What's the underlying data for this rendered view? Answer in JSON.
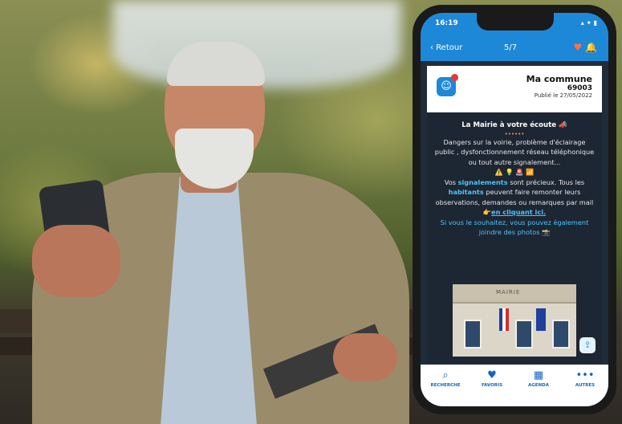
{
  "phone": {
    "status": {
      "time": "16:19",
      "system_icons": "▴ ✦ ▮"
    },
    "nav": {
      "back_label": "Retour",
      "pager": "5/7",
      "heart_icon": "heart-icon",
      "bell_icon": "bell-icon"
    },
    "card": {
      "commune_name": "Ma commune",
      "postal_code": "69003",
      "published": "Publié le 27/05/2022"
    },
    "article": {
      "title": "La Mairie à votre écoute 📣",
      "dots": "••••••",
      "p1": "Dangers sur la voirie, problème d'éclairage public , dysfonctionnement réseau téléphonique ou tout autre signalement...",
      "emoji_row": "⚠️ 💡 🚨 📶",
      "p2_a": "Vos ",
      "p2_hl1": "signalements",
      "p2_b": " sont précieux. Tous les ",
      "p2_hl2": "habitants",
      "p2_c": " peuvent faire remonter leurs observations, demandes ou remarques par mail 👉",
      "p2_link": "en cliquant ici.",
      "p3": "Si vous le souhaitez, vous pouvez également joindre des photos 📸",
      "image_sign": "MAIRIE"
    },
    "tabs": [
      {
        "label": "RECHERCHE",
        "icon": "search-icon"
      },
      {
        "label": "FAVORIS",
        "icon": "heart-icon"
      },
      {
        "label": "AGENDA",
        "icon": "calendar-icon"
      },
      {
        "label": "AUTRES",
        "icon": "more-icon"
      }
    ]
  },
  "colors": {
    "accent": "#1e88d8",
    "link": "#4fc3f7",
    "highlight": "#ff7043"
  }
}
